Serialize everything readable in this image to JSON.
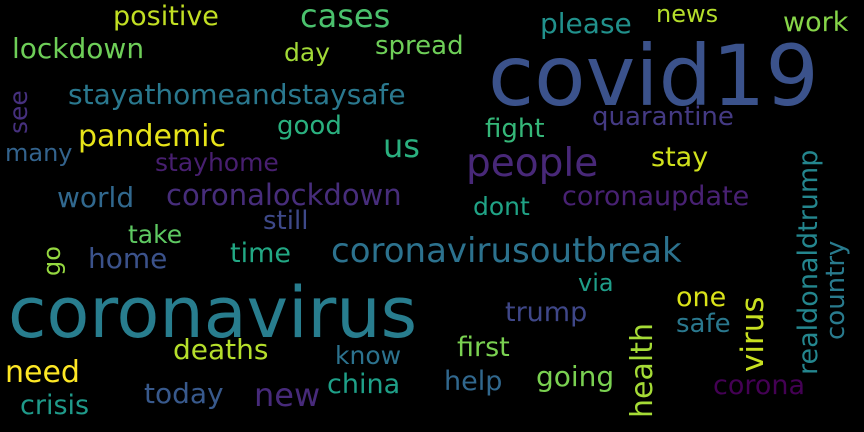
{
  "wordcloud": {
    "words": [
      {
        "text": "covid19",
        "color": "#3b528b"
      },
      {
        "text": "coronavirus",
        "color": "#287d8e"
      },
      {
        "text": "people",
        "color": "#482878"
      },
      {
        "text": "coronavirusoutbreak",
        "color": "#2c728e"
      },
      {
        "text": "coronalockdown",
        "color": "#472d7b"
      },
      {
        "text": "stayathomeandstaysafe",
        "color": "#2a788e"
      },
      {
        "text": "pandemic",
        "color": "#e7e419"
      },
      {
        "text": "cases",
        "color": "#4ac16d"
      },
      {
        "text": "lockdown",
        "color": "#6ece58"
      },
      {
        "text": "positive",
        "color": "#c2df23"
      },
      {
        "text": "please",
        "color": "#21918c"
      },
      {
        "text": "news",
        "color": "#b5de2b"
      },
      {
        "text": "work",
        "color": "#86d549"
      },
      {
        "text": "day",
        "color": "#a2da37"
      },
      {
        "text": "spread",
        "color": "#6ece58"
      },
      {
        "text": "good",
        "color": "#2ab07f"
      },
      {
        "text": "fight",
        "color": "#35b779"
      },
      {
        "text": "quarantine",
        "color": "#443a83"
      },
      {
        "text": "realdonaldtrump",
        "color": "#24868e"
      },
      {
        "text": "us",
        "color": "#2ab07f"
      },
      {
        "text": "stay",
        "color": "#d0e11c"
      },
      {
        "text": "many",
        "color": "#33638d"
      },
      {
        "text": "stayhome",
        "color": "#481f70"
      },
      {
        "text": "world",
        "color": "#31688e"
      },
      {
        "text": "dont",
        "color": "#20a386"
      },
      {
        "text": "coronaupdate",
        "color": "#482173"
      },
      {
        "text": "still",
        "color": "#3e4989"
      },
      {
        "text": "take",
        "color": "#5ec962"
      },
      {
        "text": "time",
        "color": "#22a884"
      },
      {
        "text": "home",
        "color": "#3b528b"
      },
      {
        "text": "via",
        "color": "#1f9e89"
      },
      {
        "text": "one",
        "color": "#dae319"
      },
      {
        "text": "safe",
        "color": "#2a788e"
      },
      {
        "text": "country",
        "color": "#297b8e"
      },
      {
        "text": "trump",
        "color": "#3f4788"
      },
      {
        "text": "deaths",
        "color": "#b5de2b"
      },
      {
        "text": "know",
        "color": "#2c728e"
      },
      {
        "text": "first",
        "color": "#7ad151"
      },
      {
        "text": "need",
        "color": "#fde725"
      },
      {
        "text": "new",
        "color": "#472a7a"
      },
      {
        "text": "china",
        "color": "#1fa088"
      },
      {
        "text": "help",
        "color": "#31688e"
      },
      {
        "text": "going",
        "color": "#7ad151"
      },
      {
        "text": "corona",
        "color": "#440154"
      },
      {
        "text": "crisis",
        "color": "#1f9a8a"
      },
      {
        "text": "today",
        "color": "#38598c"
      },
      {
        "text": "health",
        "color": "#a5db36"
      },
      {
        "text": "virus",
        "color": "#c8e020"
      },
      {
        "text": "see",
        "color": "#46307e"
      },
      {
        "text": "go",
        "color": "#95d840"
      }
    ]
  }
}
